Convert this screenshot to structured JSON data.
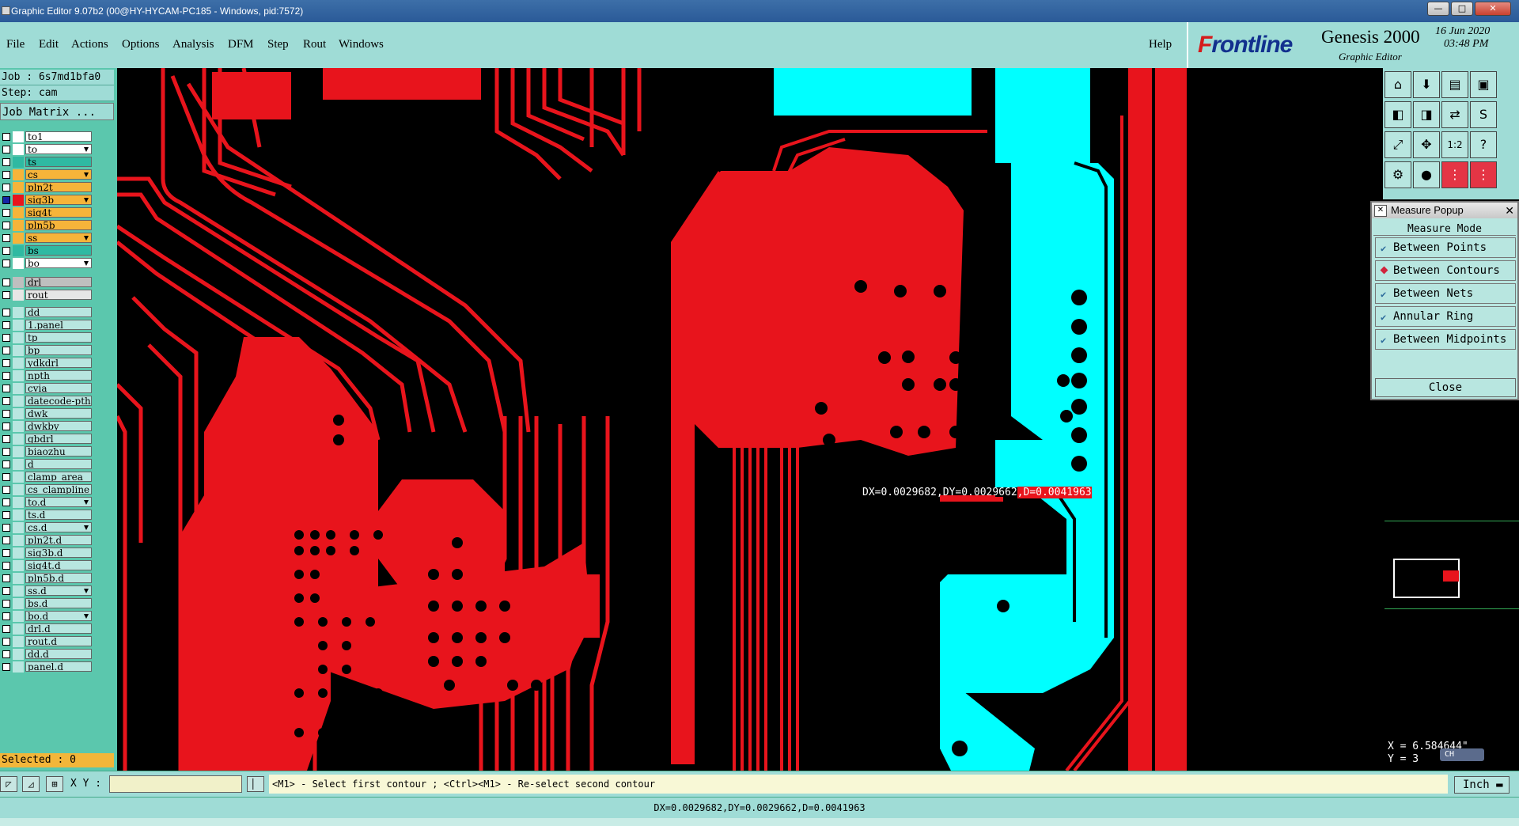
{
  "window": {
    "title": "Graphic Editor 9.07b2 (00@HY-HYCAM-PC185 - Windows, pid:7572)",
    "buttons": [
      "—",
      "□",
      "✕"
    ]
  },
  "menu": {
    "items": [
      "File",
      "Edit",
      "Actions",
      "Options",
      "Analysis",
      "DFM",
      "Step",
      "Rout",
      "Windows"
    ],
    "help": "Help"
  },
  "logo": {
    "brand_f": "F",
    "brand_rest": "rontline",
    "product": "Genesis 2000",
    "subtitle": "Graphic Editor",
    "date": "16 Jun 2020",
    "time": "03:48 PM"
  },
  "job": {
    "job_line": "Job : 6s7md1bfa0",
    "step_line": "Step: cam",
    "matrix_button": "Job Matrix ..."
  },
  "layers": [
    {
      "name": "to1",
      "color": "#ffffff",
      "swatch": "#ffffff",
      "active": false,
      "arrow": false
    },
    {
      "name": "to",
      "color": "#ffffff",
      "swatch": "#ffffff",
      "active": false,
      "arrow": true
    },
    {
      "name": "ts",
      "color": "#2fb9a2",
      "swatch": "#2fb9a2",
      "active": false,
      "arrow": false
    },
    {
      "name": "cs",
      "color": "#f6b43a",
      "swatch": "#f6b43a",
      "active": false,
      "arrow": true
    },
    {
      "name": "pln2t",
      "color": "#f6b43a",
      "swatch": "#f6b43a",
      "active": false,
      "arrow": false
    },
    {
      "name": "sig3b",
      "color": "#f6b43a",
      "swatch": "#e8141c",
      "active": true,
      "arrow": true
    },
    {
      "name": "sig4t",
      "color": "#f6b43a",
      "swatch": "#f6b43a",
      "active": false,
      "arrow": false
    },
    {
      "name": "pln5b",
      "color": "#f6b43a",
      "swatch": "#f6b43a",
      "active": false,
      "arrow": false
    },
    {
      "name": "ss",
      "color": "#f6b43a",
      "swatch": "#f6b43a",
      "active": false,
      "arrow": true
    },
    {
      "name": "bs",
      "color": "#2fb9a2",
      "swatch": "#2fb9a2",
      "active": false,
      "arrow": false
    },
    {
      "name": "bo",
      "color": "#ffffff",
      "swatch": "#ffffff",
      "active": false,
      "arrow": true
    },
    {
      "name": "drl",
      "color": "#bfbfbf",
      "swatch": "#bfbfbf",
      "active": false,
      "arrow": false
    },
    {
      "name": "rout",
      "color": "#e6e6e6",
      "swatch": "#e6e6e6",
      "active": false,
      "arrow": false
    },
    {
      "name": "dd",
      "color": "#b8e6e0",
      "swatch": "#b8e6e0",
      "active": false,
      "arrow": false
    },
    {
      "name": "1.panel",
      "color": "#b8e6e0",
      "swatch": "#b8e6e0",
      "active": false,
      "arrow": false
    },
    {
      "name": "tp",
      "color": "#b8e6e0",
      "swatch": "#b8e6e0",
      "active": false,
      "arrow": false
    },
    {
      "name": "bp",
      "color": "#b8e6e0",
      "swatch": "#b8e6e0",
      "active": false,
      "arrow": false
    },
    {
      "name": "ydkdrl",
      "color": "#b8e6e0",
      "swatch": "#b8e6e0",
      "active": false,
      "arrow": false
    },
    {
      "name": "npth",
      "color": "#b8e6e0",
      "swatch": "#b8e6e0",
      "active": false,
      "arrow": false
    },
    {
      "name": "cvia",
      "color": "#b8e6e0",
      "swatch": "#b8e6e0",
      "active": false,
      "arrow": false
    },
    {
      "name": "datecode-pth",
      "color": "#b8e6e0",
      "swatch": "#b8e6e0",
      "active": false,
      "arrow": false
    },
    {
      "name": "dwk",
      "color": "#b8e6e0",
      "swatch": "#b8e6e0",
      "active": false,
      "arrow": false
    },
    {
      "name": "dwkby",
      "color": "#b8e6e0",
      "swatch": "#b8e6e0",
      "active": false,
      "arrow": false
    },
    {
      "name": "gbdrl",
      "color": "#b8e6e0",
      "swatch": "#b8e6e0",
      "active": false,
      "arrow": false
    },
    {
      "name": "biaozhu",
      "color": "#b8e6e0",
      "swatch": "#b8e6e0",
      "active": false,
      "arrow": false
    },
    {
      "name": "d",
      "color": "#b8e6e0",
      "swatch": "#b8e6e0",
      "active": false,
      "arrow": false
    },
    {
      "name": "clamp_area",
      "color": "#b8e6e0",
      "swatch": "#b8e6e0",
      "active": false,
      "arrow": false
    },
    {
      "name": "cs_clampline",
      "color": "#b8e6e0",
      "swatch": "#b8e6e0",
      "active": false,
      "arrow": false
    },
    {
      "name": "to.d",
      "color": "#b8e6e0",
      "swatch": "#b8e6e0",
      "active": false,
      "arrow": true
    },
    {
      "name": "ts.d",
      "color": "#b8e6e0",
      "swatch": "#b8e6e0",
      "active": false,
      "arrow": false
    },
    {
      "name": "cs.d",
      "color": "#b8e6e0",
      "swatch": "#b8e6e0",
      "active": false,
      "arrow": true
    },
    {
      "name": "pln2t.d",
      "color": "#b8e6e0",
      "swatch": "#b8e6e0",
      "active": false,
      "arrow": false
    },
    {
      "name": "sig3b.d",
      "color": "#b8e6e0",
      "swatch": "#b8e6e0",
      "active": false,
      "arrow": false
    },
    {
      "name": "sig4t.d",
      "color": "#b8e6e0",
      "swatch": "#b8e6e0",
      "active": false,
      "arrow": false
    },
    {
      "name": "pln5b.d",
      "color": "#b8e6e0",
      "swatch": "#b8e6e0",
      "active": false,
      "arrow": false
    },
    {
      "name": "ss.d",
      "color": "#b8e6e0",
      "swatch": "#b8e6e0",
      "active": false,
      "arrow": true
    },
    {
      "name": "bs.d",
      "color": "#b8e6e0",
      "swatch": "#b8e6e0",
      "active": false,
      "arrow": false
    },
    {
      "name": "bo.d",
      "color": "#b8e6e0",
      "swatch": "#b8e6e0",
      "active": false,
      "arrow": true
    },
    {
      "name": "drl.d",
      "color": "#b8e6e0",
      "swatch": "#b8e6e0",
      "active": false,
      "arrow": false
    },
    {
      "name": "rout.d",
      "color": "#b8e6e0",
      "swatch": "#b8e6e0",
      "active": false,
      "arrow": false
    },
    {
      "name": "dd.d",
      "color": "#b8e6e0",
      "swatch": "#b8e6e0",
      "active": false,
      "arrow": false
    },
    {
      "name": "panel.d",
      "color": "#b8e6e0",
      "swatch": "#b8e6e0",
      "active": false,
      "arrow": false
    }
  ],
  "selected_text": "Selected : 0",
  "canvas": {
    "measure_main": "DX=0.0029682,DY=0.0029662",
    "measure_d": ",D=0.0041963",
    "colors": {
      "copper": "#e8141c",
      "highlight": "#00ffff",
      "background": "#000000"
    }
  },
  "toolbar_icons": [
    "zoom-home",
    "zoom-in-box",
    "page",
    "panel",
    "prev",
    "next",
    "flip",
    "s-icon",
    "fit",
    "center",
    "one-to-two",
    "help",
    "wrench",
    "pin",
    "net-a",
    "net-b"
  ],
  "measure_popup": {
    "title": "Measure Popup",
    "mode_title": "Measure Mode",
    "modes": [
      {
        "label": "Between Points",
        "selected": false
      },
      {
        "label": "Between Contours",
        "selected": true
      },
      {
        "label": "Between Nets",
        "selected": false
      },
      {
        "label": "Annular Ring",
        "selected": false
      },
      {
        "label": "Between Midpoints",
        "selected": false
      }
    ],
    "close_label": "Close"
  },
  "coords": {
    "x_line": "X = 6.584644\"",
    "y_line": "Y = 3",
    "ime_label": "CH"
  },
  "statusbar": {
    "xy_label": "X Y :",
    "xy_value": "",
    "prompt": "<M1> - Select first contour ; <Ctrl><M1> - Re-select second contour",
    "unit": "Inch"
  },
  "readout": "DX=0.0029682,DY=0.0029662,D=0.0041963"
}
